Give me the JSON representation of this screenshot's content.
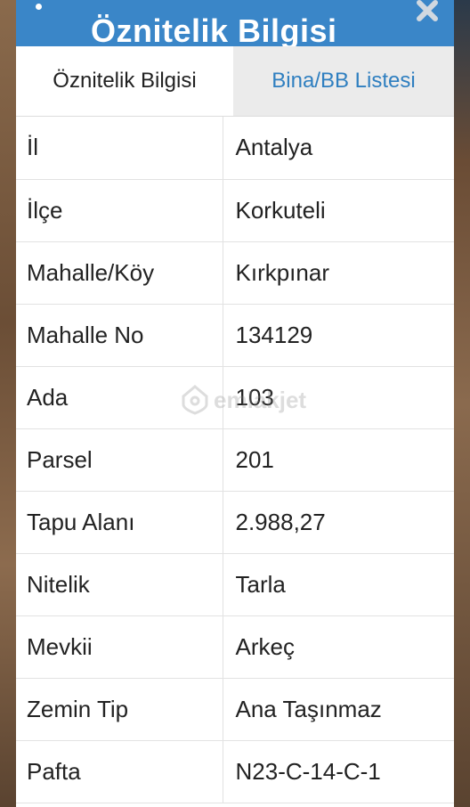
{
  "dialog": {
    "title": "Öznitelik Bilgisi",
    "close_icon": "close-icon"
  },
  "tabs": [
    {
      "label": "Öznitelik Bilgisi",
      "active": true
    },
    {
      "label": "Bina/BB Listesi",
      "active": false
    }
  ],
  "attributes": [
    {
      "key": "İl",
      "value": "Antalya"
    },
    {
      "key": "İlçe",
      "value": "Korkuteli"
    },
    {
      "key": "Mahalle/Köy",
      "value": "Kırkpınar"
    },
    {
      "key": "Mahalle No",
      "value": "134129"
    },
    {
      "key": "Ada",
      "value": "103"
    },
    {
      "key": "Parsel",
      "value": "201"
    },
    {
      "key": "Tapu Alanı",
      "value": "2.988,27"
    },
    {
      "key": "Nitelik",
      "value": "Tarla"
    },
    {
      "key": "Mevkii",
      "value": "Arkeç"
    },
    {
      "key": "Zemin Tip",
      "value": "Ana Taşınmaz"
    },
    {
      "key": "Pafta",
      "value": "N23-C-14-C-1"
    }
  ],
  "watermark": {
    "text": "emlakjet",
    "icon": "home-pin-icon"
  },
  "colors": {
    "title_bar": "#3a86c8",
    "tab_link": "#2f7fc0",
    "inactive_tab_bg": "#ebebeb"
  }
}
